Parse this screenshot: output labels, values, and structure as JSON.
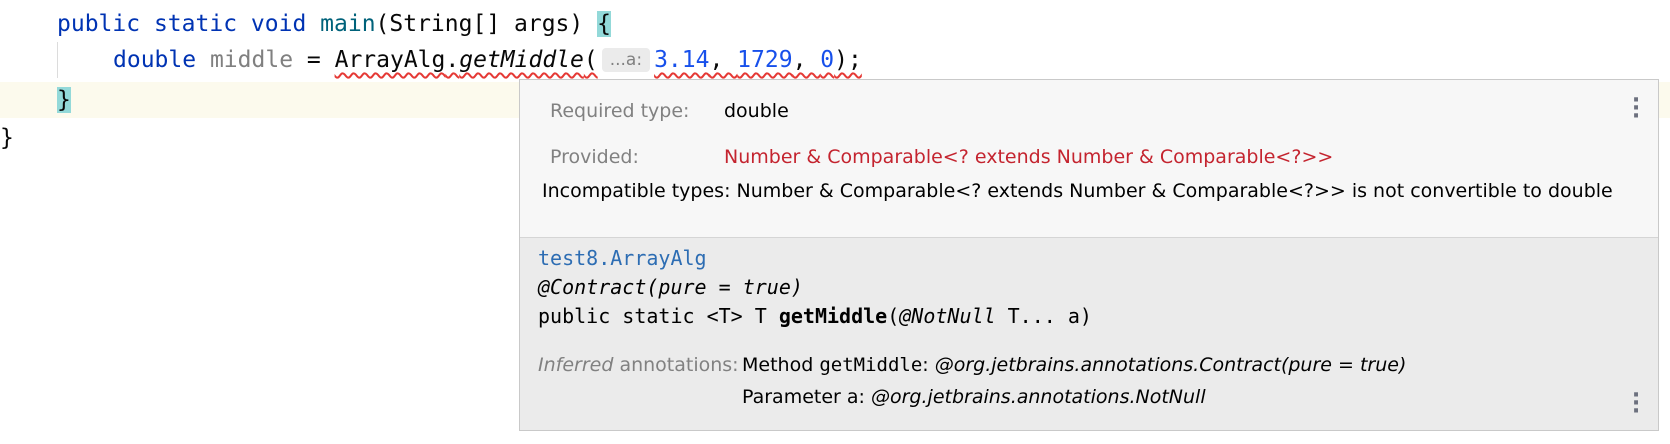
{
  "editor": {
    "line1": {
      "kw_public": "public",
      "kw_static": "static",
      "kw_void": "void",
      "method_name": "main",
      "params": "(String[] args) ",
      "open_brace": "{"
    },
    "line2": {
      "type": "double",
      "var_name": "middle",
      "assign": " = ",
      "class_name": "ArrayAlg",
      "dot": ".",
      "method_call": "getMiddle",
      "paren_open": "(",
      "inlay_hint": "...a:",
      "arg1": "3.14",
      "comma1": ", ",
      "arg2": "1729",
      "comma2": ", ",
      "arg3": "0",
      "tail": ");"
    },
    "line3_brace": "}",
    "line4_brace": "}"
  },
  "popup": {
    "required_label": "Required type:",
    "required_value": "double",
    "provided_label": "Provided:",
    "provided_value": "Number & Comparable<? extends Number & Comparable<?>>",
    "message": "Incompatible types: Number & Comparable<? extends Number & Comparable<?>> is not convertible to double",
    "doc": {
      "class_link": "test8.ArrayAlg",
      "annotation": "@Contract(pure = true)",
      "sig_prefix": "public static <T> T ",
      "sig_method": "getMiddle",
      "sig_paren": "(",
      "sig_notnull": "@NotNull",
      "sig_rest": " T... a)"
    },
    "annotations": {
      "label_italic": "Inferred",
      "label_rest": " annotations:",
      "line1_prefix": "Method ",
      "line1_method": "getMiddle",
      "line1_colon": ": ",
      "line1_value": "@org.jetbrains.annotations.Contract(pure = true)",
      "line2_prefix": "Parameter ",
      "line2_param": "a",
      "line2_colon": ": ",
      "line2_value": "@org.jetbrains.annotations.NotNull"
    }
  },
  "icons": [
    "kebab-menu-icon"
  ]
}
